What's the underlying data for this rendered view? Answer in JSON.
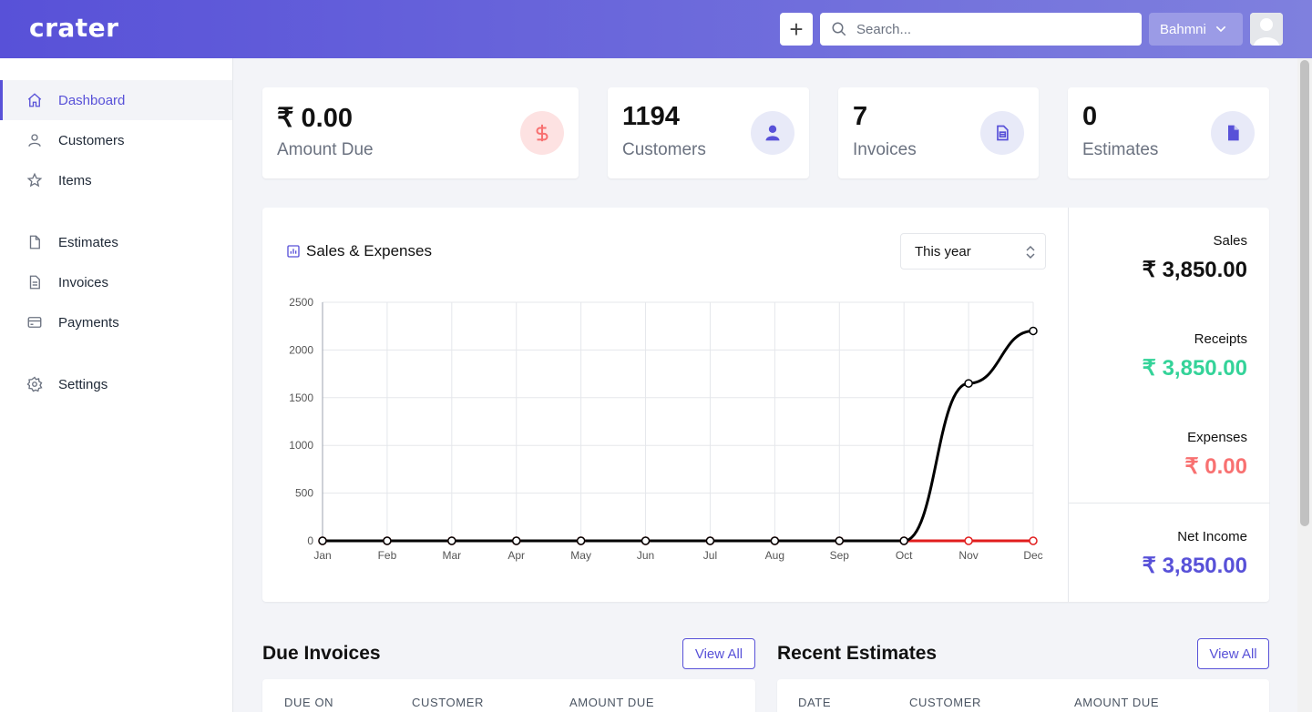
{
  "app": {
    "logo_text": "crater"
  },
  "header": {
    "search_placeholder": "Search...",
    "company": "Bahmni",
    "icons": [
      "plus-icon",
      "search-icon",
      "chevron-down-icon",
      "avatar"
    ]
  },
  "sidebar": {
    "items": [
      {
        "label": "Dashboard",
        "icon": "home-icon",
        "active": true
      },
      {
        "label": "Customers",
        "icon": "user-icon"
      },
      {
        "label": "Items",
        "icon": "star-icon"
      },
      {
        "label": "Estimates",
        "icon": "document-icon"
      },
      {
        "label": "Invoices",
        "icon": "invoice-icon"
      },
      {
        "label": "Payments",
        "icon": "credit-card-icon"
      },
      {
        "label": "Settings",
        "icon": "gear-icon"
      }
    ]
  },
  "stats": [
    {
      "value": "₹ 0.00",
      "label": "Amount Due",
      "icon": "dollar-icon"
    },
    {
      "value": "1194",
      "label": "Customers",
      "icon": "user-icon"
    },
    {
      "value": "7",
      "label": "Invoices",
      "icon": "invoice-icon"
    },
    {
      "value": "0",
      "label": "Estimates",
      "icon": "document-icon"
    }
  ],
  "chart_section": {
    "title": "Sales & Expenses",
    "period": "This year"
  },
  "summary": {
    "sales_label": "Sales",
    "sales_value": "₹ 3,850.00",
    "receipts_label": "Receipts",
    "receipts_value": "₹ 3,850.00",
    "expenses_label": "Expenses",
    "expenses_value": "₹ 0.00",
    "net_label": "Net Income",
    "net_value": "₹ 3,850.00"
  },
  "colors": {
    "brand": "#5851d8",
    "receipts": "#34d399",
    "expenses": "#f87171",
    "net_income": "#5851d8"
  },
  "chart_data": {
    "type": "line",
    "title": "Sales & Expenses",
    "categories": [
      "Jan",
      "Feb",
      "Mar",
      "Apr",
      "May",
      "Jun",
      "Jul",
      "Aug",
      "Sep",
      "Oct",
      "Nov",
      "Dec"
    ],
    "ylim": [
      0,
      2500
    ],
    "yticks": [
      0,
      500,
      1000,
      1500,
      2000,
      2500
    ],
    "grid": true,
    "series": [
      {
        "color": "#000000",
        "values": [
          0,
          0,
          0,
          0,
          0,
          0,
          0,
          0,
          0,
          0,
          1650,
          2200
        ]
      },
      {
        "color": "#e11d1d",
        "values": [
          0,
          0,
          0,
          0,
          0,
          0,
          0,
          0,
          0,
          0,
          0,
          0
        ]
      }
    ]
  },
  "due_invoices": {
    "title": "Due Invoices",
    "view_all": "View All",
    "columns": [
      "DUE ON",
      "CUSTOMER",
      "AMOUNT DUE"
    ]
  },
  "recent_estimates": {
    "title": "Recent Estimates",
    "view_all": "View All",
    "columns": [
      "DATE",
      "CUSTOMER",
      "AMOUNT DUE"
    ]
  }
}
